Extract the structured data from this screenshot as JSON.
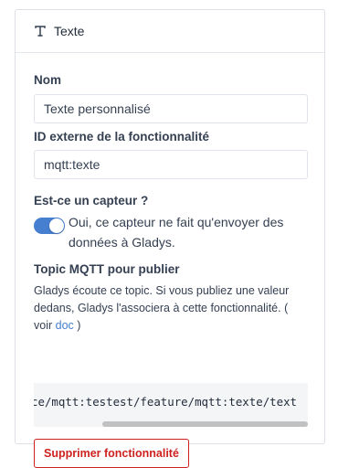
{
  "header": {
    "title": "Texte",
    "icon": "type-icon"
  },
  "name_field": {
    "label": "Nom",
    "value": "Texte personnalisé"
  },
  "external_id_field": {
    "label": "ID externe de la fonctionnalité",
    "value": "mqtt:texte"
  },
  "sensor_field": {
    "label": "Est-ce un capteur ?",
    "toggle_on": true,
    "toggle_text": "Oui, ce capteur ne fait qu'envoyer des données à Gladys."
  },
  "mqtt_topic": {
    "label": "Topic MQTT pour publier",
    "help_prefix": "Gladys écoute ce topic. Si vous publiez une valeur dedans, Gladys l'associera à cette fonctionnalité. ( voir ",
    "help_link": "doc",
    "help_suffix": " )",
    "topic": "gladys/master/device/mqtt:testest/feature/mqtt:texte/text"
  },
  "delete_button": {
    "label": "Supprimer fonctionnalité"
  },
  "colors": {
    "accent": "#467fcf",
    "danger": "#cd201f"
  }
}
